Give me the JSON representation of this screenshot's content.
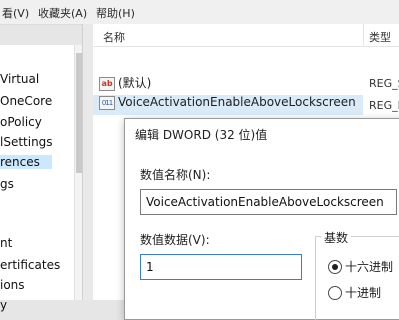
{
  "menu": {
    "view": "看(V)",
    "favorites": "收藏夹(A)",
    "help": "帮助(H)"
  },
  "tree": {
    "items": [
      "Virtual",
      "OneCore",
      "oPolicy",
      "lSettings",
      "rences",
      "gs",
      "nt",
      "ertificates",
      "ions",
      "y"
    ],
    "selected_index": 4
  },
  "list": {
    "col_name": "名称",
    "col_type": "类型",
    "rows": [
      {
        "icon": "string-value-icon",
        "name": "(默认)",
        "type": "REG_S"
      },
      {
        "icon": "dword-value-icon",
        "name": "VoiceActivationEnableAboveLockscreen",
        "type": "REG_D"
      }
    ]
  },
  "dialog": {
    "title": "编辑 DWORD (32 位)值",
    "name_label": "数值名称(N):",
    "name_value": "VoiceActivationEnableAboveLockscreen",
    "data_label": "数值数据(V):",
    "data_value": "1",
    "base_label": "基数",
    "base_hex": "十六进制",
    "base_dec": "十进制",
    "selected_base": "hex"
  }
}
